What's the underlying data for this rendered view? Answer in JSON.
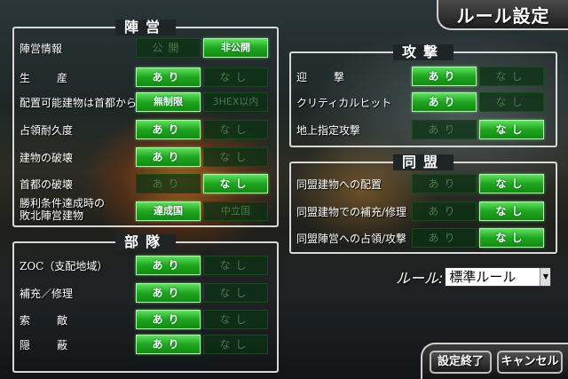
{
  "header": {
    "title": "ルール設定"
  },
  "faction": {
    "title": "陣営",
    "rows": [
      {
        "label": "陣営情報",
        "opt1": "公開",
        "opt2": "非公開",
        "selected": 2
      },
      {
        "label": "生産",
        "opt1": "あり",
        "opt2": "なし",
        "selected": 1
      },
      {
        "label": "配置可能建物は首都から",
        "opt1": "無制限",
        "opt2": "3HEX以内",
        "selected": 1
      },
      {
        "label": "占領耐久度",
        "opt1": "あり",
        "opt2": "なし",
        "selected": 1
      },
      {
        "label": "建物の破壊",
        "opt1": "あり",
        "opt2": "なし",
        "selected": 1
      },
      {
        "label": "首都の破壊",
        "opt1": "あり",
        "opt2": "なし",
        "selected": 2
      },
      {
        "label_line1": "勝利条件達成時の",
        "label_line2": "敗北陣営建物",
        "opt1": "達成国",
        "opt2": "中立国",
        "selected": 1
      }
    ]
  },
  "units": {
    "title": "部隊",
    "rows": [
      {
        "label": "ZOC（支配地域）",
        "opt1": "あり",
        "opt2": "なし",
        "selected": 1
      },
      {
        "label": "補充／修理",
        "opt1": "あり",
        "opt2": "なし",
        "selected": 1
      },
      {
        "label": "索敵",
        "opt1": "あり",
        "opt2": "なし",
        "selected": 1
      },
      {
        "label": "隠蔽",
        "opt1": "あり",
        "opt2": "なし",
        "selected": 1
      }
    ]
  },
  "attack": {
    "title": "攻撃",
    "rows": [
      {
        "label": "迎撃",
        "opt1": "あり",
        "opt2": "なし",
        "selected": 1
      },
      {
        "label": "クリティカルヒット",
        "opt1": "あり",
        "opt2": "なし",
        "selected": 1
      },
      {
        "label": "地上指定攻撃",
        "opt1": "あり",
        "opt2": "なし",
        "selected": 2
      }
    ]
  },
  "alliance": {
    "title": "同盟",
    "rows": [
      {
        "label": "同盟建物への配置",
        "opt1": "あり",
        "opt2": "なし",
        "selected": 2
      },
      {
        "label": "同盟建物での補充/修理",
        "opt1": "あり",
        "opt2": "なし",
        "selected": 2
      },
      {
        "label": "同盟陣営への占領/攻撃",
        "opt1": "あり",
        "opt2": "なし",
        "selected": 2
      }
    ]
  },
  "rule": {
    "label": "ルール:",
    "value": "標準ルール"
  },
  "footer": {
    "finish_label": "設定終了",
    "cancel_label": "キャンセル"
  },
  "colors": {
    "active": "#22aa22",
    "inactive": "#0a3214",
    "frame": "#d8d8d8"
  }
}
